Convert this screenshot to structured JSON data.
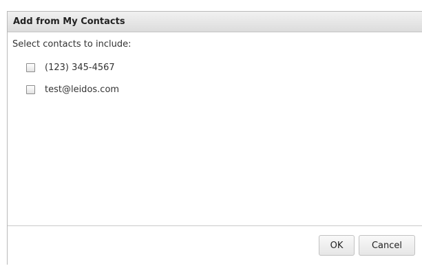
{
  "dialog": {
    "title": "Add from My Contacts",
    "instructions": "Select contacts to include:",
    "contacts": [
      {
        "label": "(123) 345-4567",
        "checked": false
      },
      {
        "label": "test@leidos.com",
        "checked": false
      }
    ],
    "buttons": {
      "ok": "OK",
      "cancel": "Cancel"
    }
  }
}
